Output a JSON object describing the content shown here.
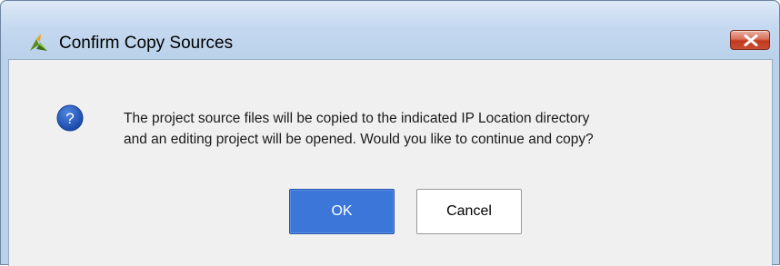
{
  "dialog": {
    "title": "Confirm Copy Sources",
    "icon": "vivado-logo-icon",
    "close_icon": "close-x-icon",
    "message_icon": "question-icon",
    "message_icon_glyph": "?",
    "message_lines": [
      "The project source files will be copied to the indicated IP Location directory",
      "and an editing project will be opened. Would you like to continue and copy?"
    ],
    "buttons": {
      "ok_label": "OK",
      "cancel_label": "Cancel"
    }
  },
  "colors": {
    "titlebar": "#b9d1ea",
    "close_button": "#c2391f",
    "primary_button": "#3b76d8",
    "question_icon": "#1e50b4",
    "client_background": "#f0f0f0"
  }
}
